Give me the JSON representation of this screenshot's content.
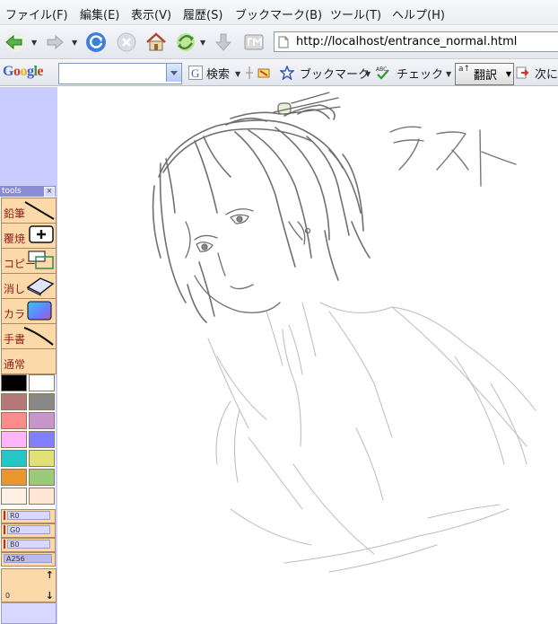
{
  "menu": {
    "items": [
      {
        "label": "ファイル(F)"
      },
      {
        "label": "編集(E)"
      },
      {
        "label": "表示(V)"
      },
      {
        "label": "履歴(S)"
      },
      {
        "label": "ブックマーク(B)"
      },
      {
        "label": "ツール(T)"
      },
      {
        "label": "ヘルプ(H)"
      }
    ]
  },
  "navigation": {
    "buttons": [
      "back-icon",
      "forward-icon",
      "reload-icon",
      "stop-icon",
      "home-icon",
      "sync-icon",
      "download-icon",
      "addon-icon"
    ],
    "url": "http://localhost/entrance_normal.html"
  },
  "google_toolbar": {
    "logo": "Google",
    "search_value": "",
    "search_button": "検索",
    "bookmarks_button": "ブックマーク",
    "check_button": "チェック",
    "translate_button": "翻訳",
    "translate_icon_text": "a↑",
    "next_button": "次に",
    "colors": {
      "g_blue": "#3a63c9",
      "g_red": "#cf3b2a",
      "g_yellow": "#e3b21b",
      "g_green": "#2f9a38"
    }
  },
  "tools_panel": {
    "title": "tools",
    "close": "×",
    "tools": [
      {
        "label": "鉛筆",
        "icon": "pencil-line-icon"
      },
      {
        "label": "覆焼",
        "icon": "dodge-plus-icon"
      },
      {
        "label": "コピー",
        "icon": "copy-rect-icon"
      },
      {
        "label": "消し",
        "icon": "eraser-icon"
      },
      {
        "label": "カラ",
        "icon": "color-gradient-icon"
      },
      {
        "label": "手書",
        "icon": "handwrite-curve-icon"
      },
      {
        "label": "通常",
        "icon": ""
      }
    ],
    "swatches": [
      [
        "#000000",
        "#ffffff"
      ],
      [
        "#b47878",
        "#888888"
      ],
      [
        "#fa8c8c",
        "#c896c8"
      ],
      [
        "#ffb4ff",
        "#8080ff"
      ],
      [
        "#25c6c6",
        "#e1e178"
      ],
      [
        "#e8962d",
        "#99cb7b"
      ],
      [
        "#fff0e6",
        "#ffe6d6"
      ]
    ],
    "sliders": [
      {
        "label": "R0",
        "value": 0
      },
      {
        "label": "G0",
        "value": 0
      },
      {
        "label": "B0",
        "value": 0
      },
      {
        "label": "A256",
        "value": 256
      }
    ],
    "layer_value": "0",
    "layer_up": "↑",
    "layer_down": "↓"
  },
  "canvas": {
    "handwriting": "テスト",
    "background": "#ffffff",
    "frame_color": "#c8ccff"
  }
}
